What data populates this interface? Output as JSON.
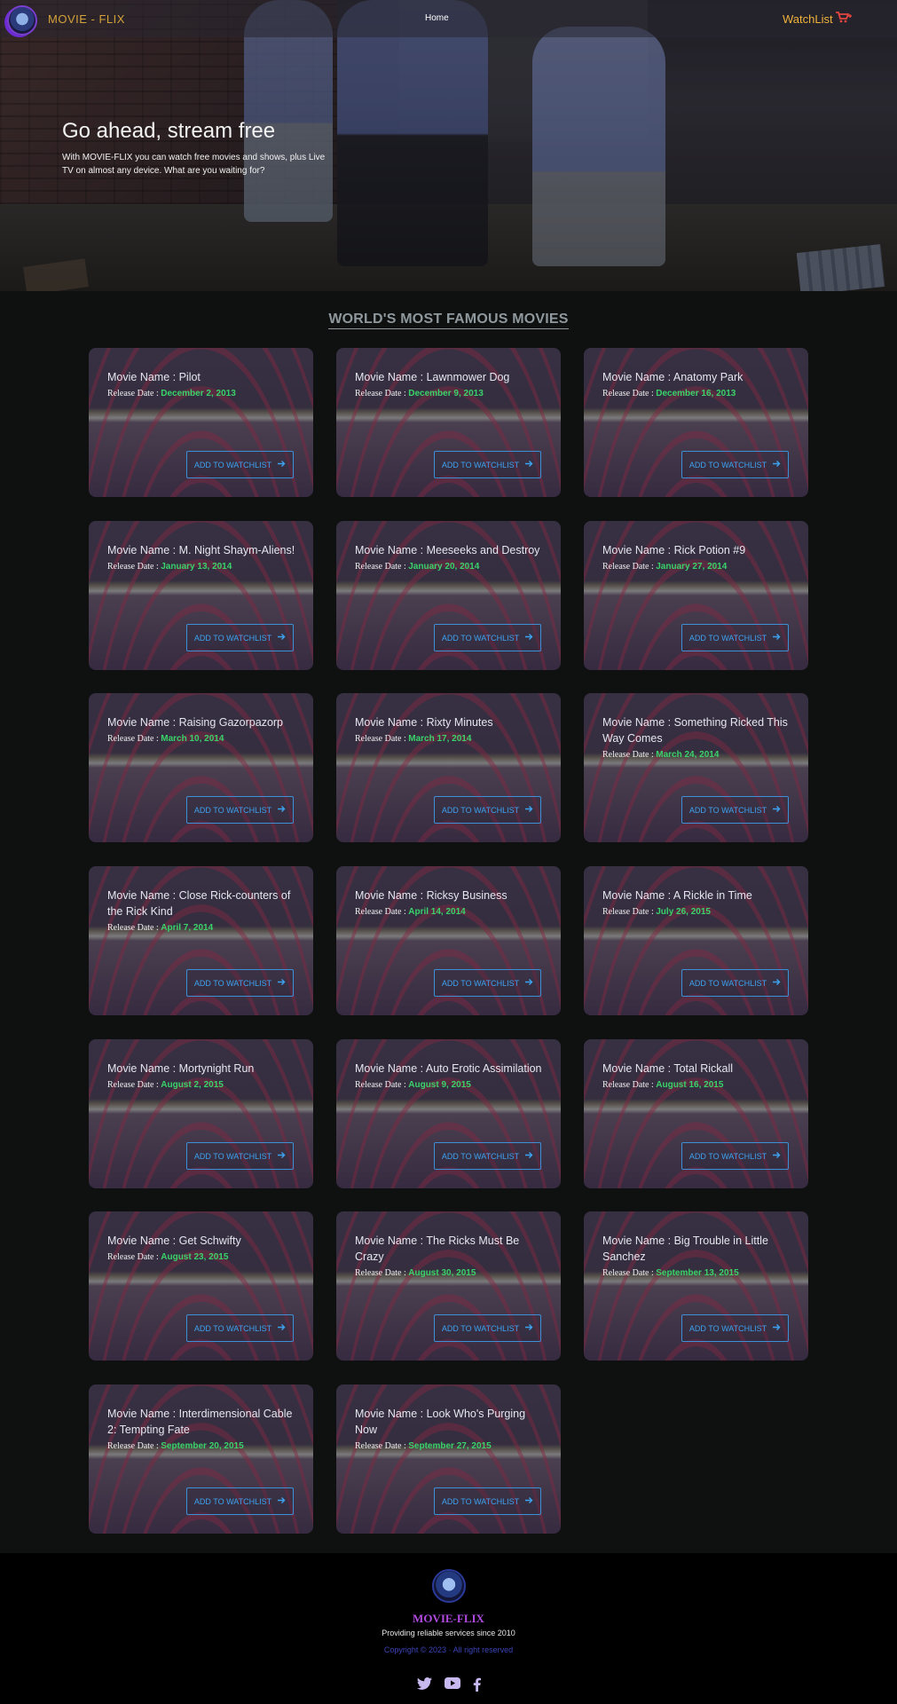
{
  "nav": {
    "brand": "MOVIE - FLIX",
    "home": "Home",
    "watchlist": "WatchList",
    "cart_icon": "cart-plus-icon"
  },
  "hero": {
    "title": "Go ahead, stream free",
    "text": "With MOVIE-FLIX you can watch free movies and shows, plus Live TV on almost any device. What are you waiting for?"
  },
  "section": {
    "title": "WORLD'S MOST FAMOUS MOVIES"
  },
  "card_labels": {
    "name_prefix": "Movie Name : ",
    "date_prefix": "Release Date : ",
    "button": "ADD TO WATCHLIST",
    "button_icon": "arrow-right-icon"
  },
  "movies": [
    {
      "name": "Pilot",
      "date": "December 2, 2013"
    },
    {
      "name": "Lawnmower Dog",
      "date": "December 9, 2013"
    },
    {
      "name": "Anatomy Park",
      "date": "December 16, 2013"
    },
    {
      "name": "M. Night Shaym-Aliens!",
      "date": "January 13, 2014"
    },
    {
      "name": "Meeseeks and Destroy",
      "date": "January 20, 2014"
    },
    {
      "name": "Rick Potion #9",
      "date": "January 27, 2014"
    },
    {
      "name": "Raising Gazorpazorp",
      "date": "March 10, 2014"
    },
    {
      "name": "Rixty Minutes",
      "date": "March 17, 2014"
    },
    {
      "name": "Something Ricked This Way Comes",
      "date": "March 24, 2014"
    },
    {
      "name": "Close Rick-counters of the Rick Kind",
      "date": "April 7, 2014"
    },
    {
      "name": "Ricksy Business",
      "date": "April 14, 2014"
    },
    {
      "name": "A Rickle in Time",
      "date": "July 26, 2015"
    },
    {
      "name": "Mortynight Run",
      "date": "August 2, 2015"
    },
    {
      "name": "Auto Erotic Assimilation",
      "date": "August 9, 2015"
    },
    {
      "name": "Total Rickall",
      "date": "August 16, 2015"
    },
    {
      "name": "Get Schwifty",
      "date": "August 23, 2015"
    },
    {
      "name": "The Ricks Must Be Crazy",
      "date": "August 30, 2015"
    },
    {
      "name": "Big Trouble in Little Sanchez",
      "date": "September 13, 2015"
    },
    {
      "name": "Interdimensional Cable 2: Tempting Fate",
      "date": "September 20, 2015"
    },
    {
      "name": "Look Who's Purging Now",
      "date": "September 27, 2015"
    }
  ],
  "footer": {
    "brand": "MOVIE-FLIX",
    "tagline": "Providing reliable services since 2010",
    "copyright": "Copyright © 2023 · All right reserved",
    "social_icons": [
      "twitter-icon",
      "youtube-icon",
      "facebook-icon"
    ]
  },
  "colors": {
    "brand": "#d4a23a",
    "date": "#3ad26a",
    "button": "#3da2f0",
    "footer_brand": "#b14be0",
    "cart": "#e2463e"
  }
}
